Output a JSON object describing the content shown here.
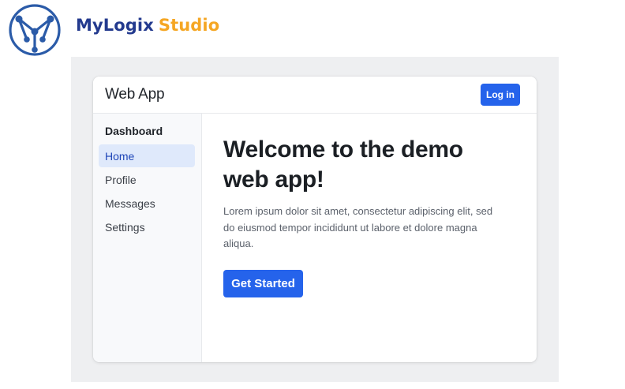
{
  "brand": {
    "logo_icon": "mylogix-network-logo-icon",
    "name_part1": "MyLogix",
    "name_part2": "Studio",
    "colors": {
      "primary": "#233a8e",
      "accent": "#f5a623",
      "logo": "#2b5ba8"
    }
  },
  "app": {
    "title": "Web App",
    "login_label": "Log in",
    "accent_color": "#2563eb"
  },
  "sidebar": {
    "heading": "Dashboard",
    "items": [
      {
        "label": "Home",
        "active": true
      },
      {
        "label": "Profile",
        "active": false
      },
      {
        "label": "Messages",
        "active": false
      },
      {
        "label": "Settings",
        "active": false
      }
    ]
  },
  "main": {
    "headline": "Welcome to the demo web app!",
    "body": "Lorem ipsum dolor sit amet, consectetur adipiscing elit, sed do eiusmod tempor incididunt ut labore et dolore magna aliqua.",
    "cta_label": "Get Started"
  }
}
